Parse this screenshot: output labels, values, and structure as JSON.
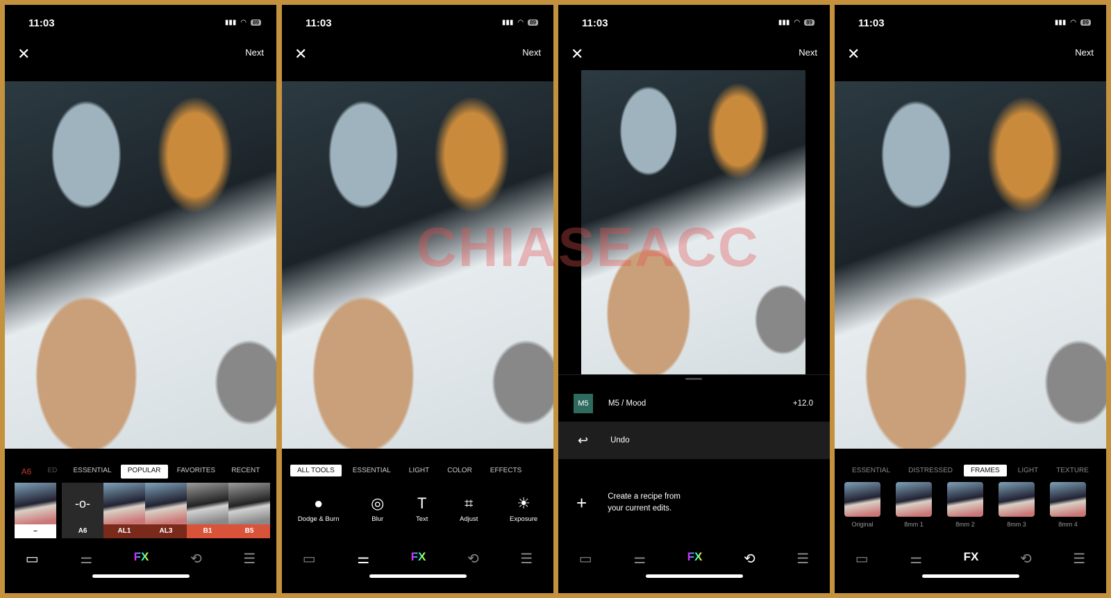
{
  "status": {
    "time": "11:03",
    "battery": "89"
  },
  "header": {
    "close": "✕",
    "next": "Next"
  },
  "panel1": {
    "tabs": [
      "A6",
      "ED",
      "ESSENTIAL",
      "POPULAR",
      "FAVORITES",
      "RECENT"
    ],
    "active_tab": "POPULAR",
    "presets": [
      {
        "label": "–"
      },
      {
        "label": "A6"
      },
      {
        "label": "AL1",
        "color": "#7a2a1a"
      },
      {
        "label": "AL3",
        "color": "#7a2a1a"
      },
      {
        "label": "B1",
        "color": "#d9533a"
      },
      {
        "label": "B5",
        "color": "#d9533a"
      }
    ]
  },
  "panel2": {
    "tabs": [
      "ALL TOOLS",
      "ESSENTIAL",
      "LIGHT",
      "COLOR",
      "EFFECTS"
    ],
    "active_tab": "ALL TOOLS",
    "tools": [
      {
        "label": "Dodge & Burn",
        "icon": "●"
      },
      {
        "label": "Blur",
        "icon": "◎"
      },
      {
        "label": "Text",
        "icon": "T"
      },
      {
        "label": "Adjust",
        "icon": "⌗"
      },
      {
        "label": "Exposure",
        "icon": "☀"
      }
    ]
  },
  "panel3": {
    "preset_badge": "M5",
    "preset_name": "M5 / Mood",
    "preset_value": "+12.0",
    "undo": "Undo",
    "recipe_line1": "Create a recipe from",
    "recipe_line2": "your current edits."
  },
  "panel4": {
    "tabs": [
      "ESSENTIAL",
      "DISTRESSED",
      "FRAMES",
      "LIGHT",
      "TEXTURE"
    ],
    "active_tab": "FRAMES",
    "frames": [
      "Original",
      "8mm 1",
      "8mm 2",
      "8mm 3",
      "8mm 4"
    ]
  },
  "toolbar": {
    "presets": "▭",
    "tools": "⚌",
    "fx": "FX",
    "history": "⟲",
    "recipes": "☰"
  },
  "watermark": "CHIASEACC",
  "colors": {
    "frame": "#c4923e",
    "m5_badge": "#2f6a5f"
  }
}
